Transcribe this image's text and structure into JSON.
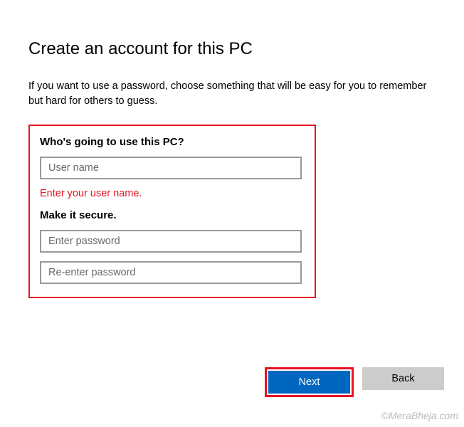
{
  "title": "Create an account for this PC",
  "description": "If you want to use a password, choose something that will be easy for you to remember but hard for others to guess.",
  "section1": {
    "label": "Who's going to use this PC?",
    "username_placeholder": "User name",
    "error": "Enter your user name."
  },
  "section2": {
    "label": "Make it secure.",
    "password_placeholder": "Enter password",
    "reenter_placeholder": "Re-enter password"
  },
  "buttons": {
    "next": "Next",
    "back": "Back"
  },
  "watermark": "©MeraBheja.com"
}
